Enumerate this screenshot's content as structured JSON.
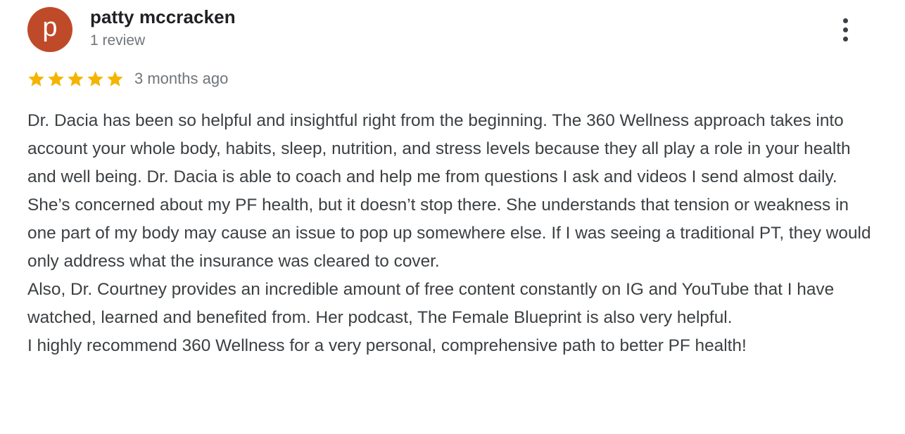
{
  "reviewer": {
    "initial": "p",
    "name": "patty mccracken",
    "review_count": "1 review",
    "avatar_color": "#bf4a2a"
  },
  "menu": {
    "icon": "more-vert-icon"
  },
  "rating": {
    "stars": 5,
    "max_stars": 5,
    "star_color": "#f4b400",
    "time_ago": "3 months ago"
  },
  "review": {
    "text": "Dr. Dacia has been so helpful and insightful right from the beginning. The 360 Wellness approach takes into account your whole body, habits, sleep, nutrition, and stress levels because they all play a role in your health and well being. Dr. Dacia is able to coach and help me from questions I ask and videos I send almost daily. She’s concerned about my PF health, but it doesn’t stop there. She understands that tension or weakness in one part of my body may cause an issue to pop up somewhere else. If I was seeing a traditional PT, they would only address what the insurance was cleared to cover.\nAlso, Dr. Courtney provides an incredible amount of free content constantly on IG and YouTube that I have watched, learned and benefited from. Her podcast, The Female Blueprint is also very helpful.\nI highly recommend 360 Wellness for a very personal, comprehensive path to better PF health!"
  }
}
